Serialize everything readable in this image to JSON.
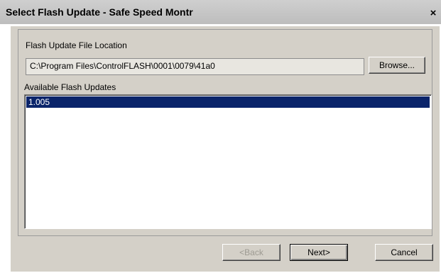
{
  "window": {
    "title": "Select Flash Update - Safe Speed Montr",
    "close_glyph": "×"
  },
  "location": {
    "label": "Flash Update File Location",
    "path": "C:\\Program Files\\ControlFLASH\\0001\\0079\\41a0",
    "browse_label": "Browse..."
  },
  "updates": {
    "label": "Available Flash Updates",
    "items": [
      "1.005"
    ],
    "selected_index": 0
  },
  "buttons": {
    "back": "<Back",
    "next": "Next>",
    "cancel": "Cancel"
  },
  "colors": {
    "selection": "#0a246a",
    "dialog_bg": "#d4d0c8"
  }
}
